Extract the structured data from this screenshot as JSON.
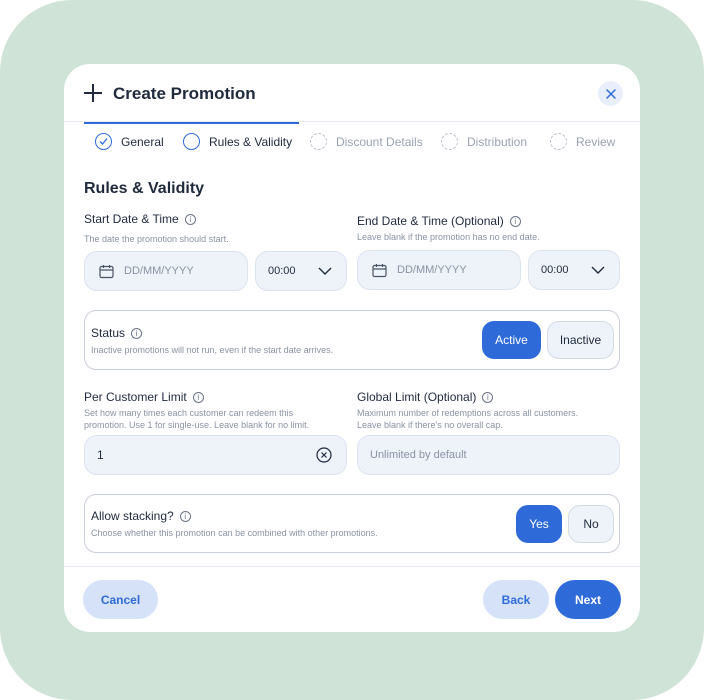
{
  "modal": {
    "title": "Create Promotion"
  },
  "steps": [
    {
      "label": "General",
      "state": "done"
    },
    {
      "label": "Rules & Validity",
      "state": "current"
    },
    {
      "label": "Discount Details",
      "state": "todo"
    },
    {
      "label": "Distribution",
      "state": "todo"
    },
    {
      "label": "Review",
      "state": "todo"
    }
  ],
  "section": {
    "title": "Rules & Validity"
  },
  "start": {
    "label": "Start Date & Time",
    "hint": "The date the promotion should start.",
    "date_placeholder": "DD/MM/YYYY",
    "time_value": "00:00"
  },
  "end": {
    "label": "End Date & Time (Optional)",
    "hint": "Leave blank if the promotion has no end date.",
    "date_placeholder": "DD/MM/YYYY",
    "time_value": "00:00"
  },
  "status": {
    "label": "Status",
    "hint": "Inactive promotions will not run, even if the start date arrives.",
    "active_label": "Active",
    "inactive_label": "Inactive"
  },
  "per_customer": {
    "label": "Per Customer Limit",
    "hint_line1": "Set how many times each customer can redeem this",
    "hint_line2": "promotion. Use 1 for single-use. Leave blank for no limit.",
    "value": "1"
  },
  "global_limit": {
    "label": "Global Limit (Optional)",
    "hint_line1": "Maximum number of redemptions across all customers.",
    "hint_line2": "Leave blank if there's no overall cap.",
    "placeholder": "Unlimited by default"
  },
  "stacking": {
    "label": "Allow stacking?",
    "hint": "Choose whether this promotion can be combined with other promotions.",
    "yes_label": "Yes",
    "no_label": "No"
  },
  "footer": {
    "cancel_label": "Cancel",
    "back_label": "Back",
    "next_label": "Next"
  },
  "colors": {
    "accent": "#2f6bd8",
    "background": "#cfe4d6",
    "field": "#eef3fa"
  }
}
